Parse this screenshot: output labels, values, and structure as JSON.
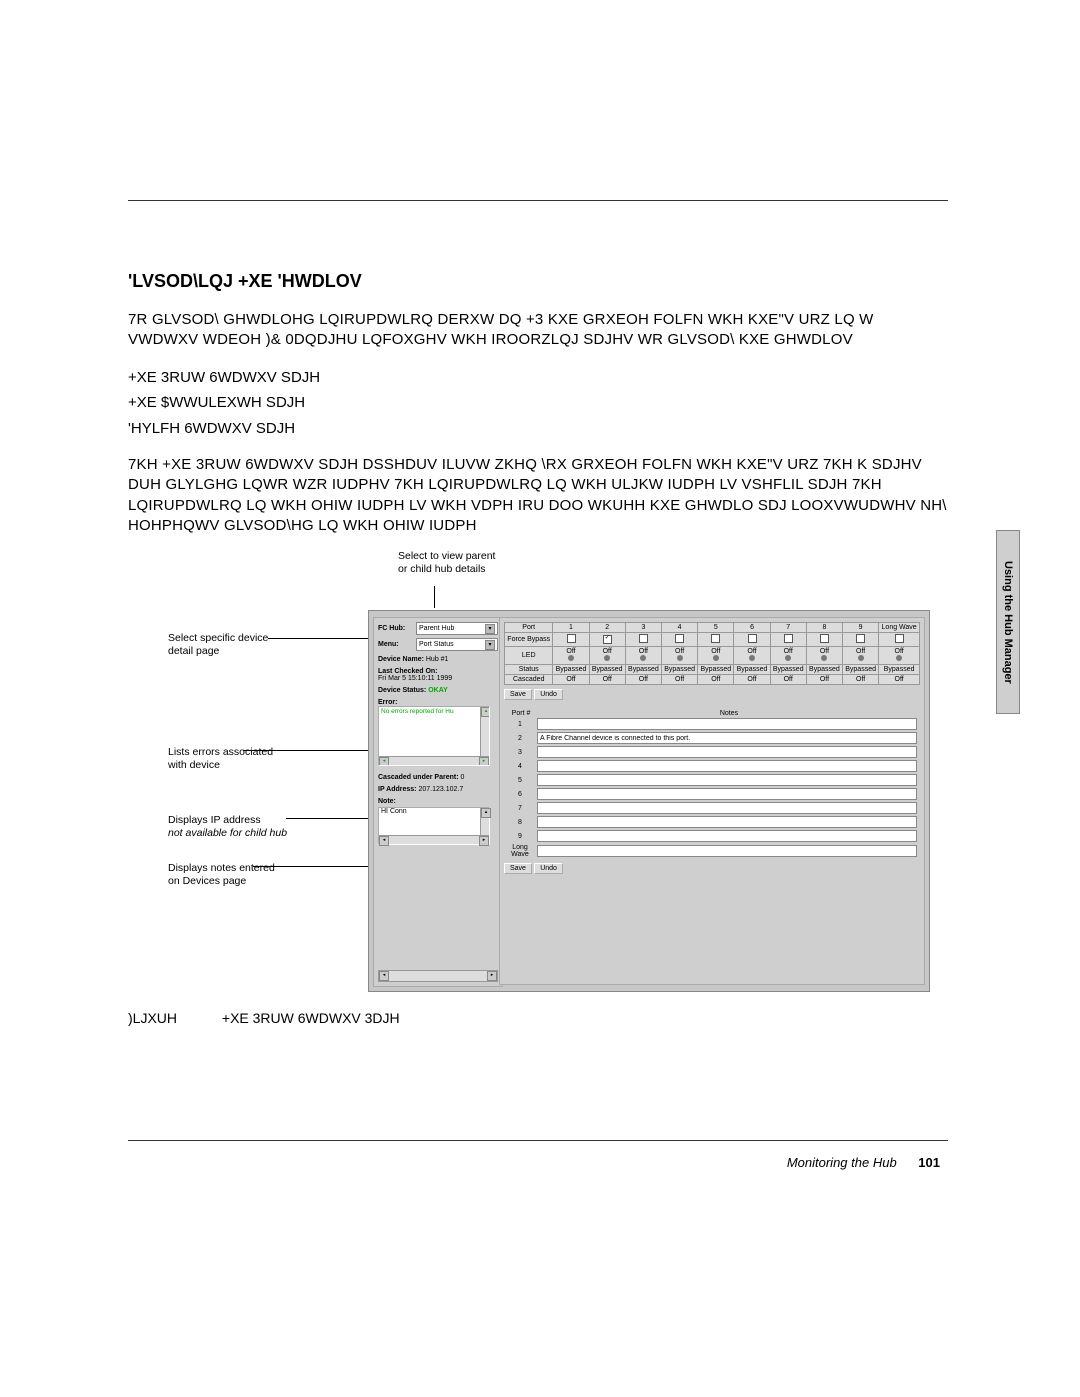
{
  "header_rule": true,
  "section_title": "'LVSOD\\LQJ +XE 'HWDLOV",
  "para1": "7R GLVSOD\\ GHWDLOHG LQIRUPDWLRQ DERXW DQ +3 KXE  GRXEOH FOLFN WKH KXE\"V URZ LQ W VWDWXV WDEOH  )& 0DQDJHU LQFOXGHV WKH IROORZLQJ SDJHV WR GLVSOD\\ KXE GHWDLOV",
  "list": [
    "+XE 3RUW 6WDWXV SDJH",
    "+XE $WWULEXWH SDJH",
    "'HYLFH 6WDWXV SDJH"
  ],
  "para2": "7KH +XE 3RUW 6WDWXV SDJH DSSHDUV ILUVW ZKHQ \\RX GRXEOH FOLFN WKH KXE\"V URZ  7KH K SDJHV DUH GLYLGHG LQWR WZR IUDPHV  7KH LQIRUPDWLRQ LQ WKH ULJKW IUDPH LV VSHFLIL SDJH  7KH LQIRUPDWLRQ LQ WKH OHIW IUDPH LV WKH VDPH IRU DOO WKUHH KXE GHWDLO SDJ LOOXVWUDWHV NH\\ HOHPHQWV GLVSOD\\HG LQ WKH OHIW IUDPH",
  "callouts": {
    "top": "Select to view parent or child hub details",
    "c1": "Select specific device detail page",
    "c2": "Lists errors associated with device",
    "c3": "Displays IP address",
    "c3i": "not available for child hub",
    "c4": "Displays notes entered on Devices page"
  },
  "left_panel": {
    "fc_hub_label": "FC Hub:",
    "fc_hub_value": "Parent Hub",
    "menu_label": "Menu:",
    "menu_value": "Port Status",
    "device_name_label": "Device Name:",
    "device_name_value": "Hub #1",
    "last_checked_label": "Last Checked On:",
    "last_checked_value": "Fri Mar 5 15:10:11 1999",
    "device_status_label": "Device Status:",
    "device_status_value": "OKAY",
    "error_label": "Error:",
    "error_value": "No errors reported for Hu",
    "cascaded_label": "Cascaded under Parent:",
    "cascaded_value": "0",
    "ip_label": "IP Address:",
    "ip_value": "207.123.102.7",
    "note_label": "Note:",
    "note_value": "HI Conn"
  },
  "port_table": {
    "headers": [
      "Port",
      "1",
      "2",
      "3",
      "4",
      "5",
      "6",
      "7",
      "8",
      "9",
      "Long Wave"
    ],
    "rows": [
      {
        "label": "Force Bypass",
        "type": "cb",
        "on": [
          2
        ]
      },
      {
        "label": "LED",
        "type": "led",
        "vals": [
          "Off",
          "Off",
          "Off",
          "Off",
          "Off",
          "Off",
          "Off",
          "Off",
          "Off",
          "Off"
        ]
      },
      {
        "label": "Status",
        "type": "txt",
        "vals": [
          "Bypassed",
          "Bypassed",
          "Bypassed",
          "Bypassed",
          "Bypassed",
          "Bypassed",
          "Bypassed",
          "Bypassed",
          "Bypassed",
          "Bypassed"
        ]
      },
      {
        "label": "Cascaded",
        "type": "txt",
        "vals": [
          "Off",
          "Off",
          "Off",
          "Off",
          "Off",
          "Off",
          "Off",
          "Off",
          "Off",
          "Off"
        ]
      }
    ],
    "buttons": [
      "Save",
      "Undo"
    ]
  },
  "notes_table": {
    "col1": "Port #",
    "col2": "Notes",
    "rows": [
      {
        "n": "1",
        "note": ""
      },
      {
        "n": "2",
        "note": "A Fibre Channel device is connected to this port."
      },
      {
        "n": "3",
        "note": ""
      },
      {
        "n": "4",
        "note": ""
      },
      {
        "n": "5",
        "note": ""
      },
      {
        "n": "6",
        "note": ""
      },
      {
        "n": "7",
        "note": ""
      },
      {
        "n": "8",
        "note": ""
      },
      {
        "n": "9",
        "note": ""
      },
      {
        "n": "Long Wave",
        "note": ""
      }
    ],
    "buttons": [
      "Save",
      "Undo"
    ]
  },
  "figure_caption_label": ")LJXUH",
  "figure_caption_text": "+XE 3RUW 6WDWXV 3DJH",
  "side_tab": "Using the Hub Manager",
  "footer_section": "Monitoring the Hub",
  "footer_page": "101"
}
